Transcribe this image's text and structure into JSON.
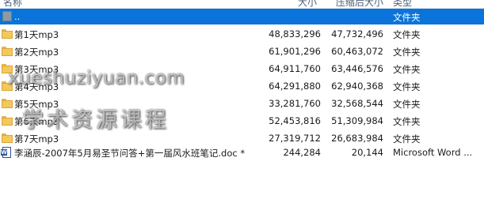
{
  "header": {
    "name_label": "名称",
    "size_label": "大小",
    "packed_label": "压缩后大小",
    "type_label": "类型"
  },
  "rows": [
    {
      "icon": "up-folder-icon",
      "name": "..",
      "size": "",
      "packed": "",
      "type": "文件夹",
      "selected": true
    },
    {
      "icon": "folder-icon",
      "name": "第1天mp3",
      "size": "48,833,296",
      "packed": "47,732,496",
      "type": "文件夹"
    },
    {
      "icon": "folder-icon",
      "name": "第2天mp3",
      "size": "61,901,296",
      "packed": "60,463,072",
      "type": "文件夹"
    },
    {
      "icon": "folder-icon",
      "name": "第3天mp3",
      "size": "64,911,760",
      "packed": "63,446,576",
      "type": "文件夹"
    },
    {
      "icon": "folder-icon",
      "name": "第4天mp3",
      "size": "64,291,880",
      "packed": "62,940,368",
      "type": "文件夹"
    },
    {
      "icon": "folder-icon",
      "name": "第5天mp3",
      "size": "33,281,760",
      "packed": "32,568,544",
      "type": "文件夹"
    },
    {
      "icon": "folder-icon",
      "name": "第6天mp3",
      "size": "52,453,816",
      "packed": "51,309,984",
      "type": "文件夹"
    },
    {
      "icon": "folder-icon",
      "name": "第7天mp3",
      "size": "27,319,712",
      "packed": "26,683,984",
      "type": "文件夹"
    },
    {
      "icon": "word-document-icon",
      "name": "李涵辰-2007年5月易圣节问答+第一届风水班笔记.doc *",
      "size": "244,284",
      "packed": "20,144",
      "type": "Microsoft Word ..."
    }
  ],
  "watermark": {
    "line1": "xueshuziyuan.com",
    "line2": "学术资源课程"
  },
  "colors": {
    "selection": "#0a74da",
    "folder": "#f4c85a",
    "header_text": "#4c607a"
  }
}
